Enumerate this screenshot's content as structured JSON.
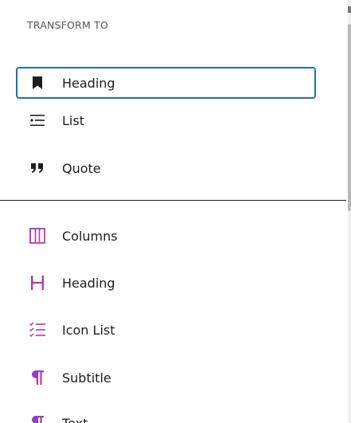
{
  "section": {
    "transform_label": "TRANSFORM TO"
  },
  "transform_items": [
    {
      "label": "Heading",
      "icon": "bookmark-icon"
    },
    {
      "label": "List",
      "icon": "list-icon"
    },
    {
      "label": "Quote",
      "icon": "quote-icon"
    }
  ],
  "block_items": [
    {
      "label": "Columns",
      "icon": "columns-icon"
    },
    {
      "label": "Heading",
      "icon": "heading-icon"
    },
    {
      "label": "Icon List",
      "icon": "icon-list-icon"
    },
    {
      "label": "Subtitle",
      "icon": "paragraph-icon"
    },
    {
      "label": "Text",
      "icon": "paragraph-icon"
    }
  ],
  "colors": {
    "focus_border": "#2271b1",
    "block_icon_gradient_start": "#7b3fe4",
    "block_icon_gradient_end": "#e0347a"
  }
}
